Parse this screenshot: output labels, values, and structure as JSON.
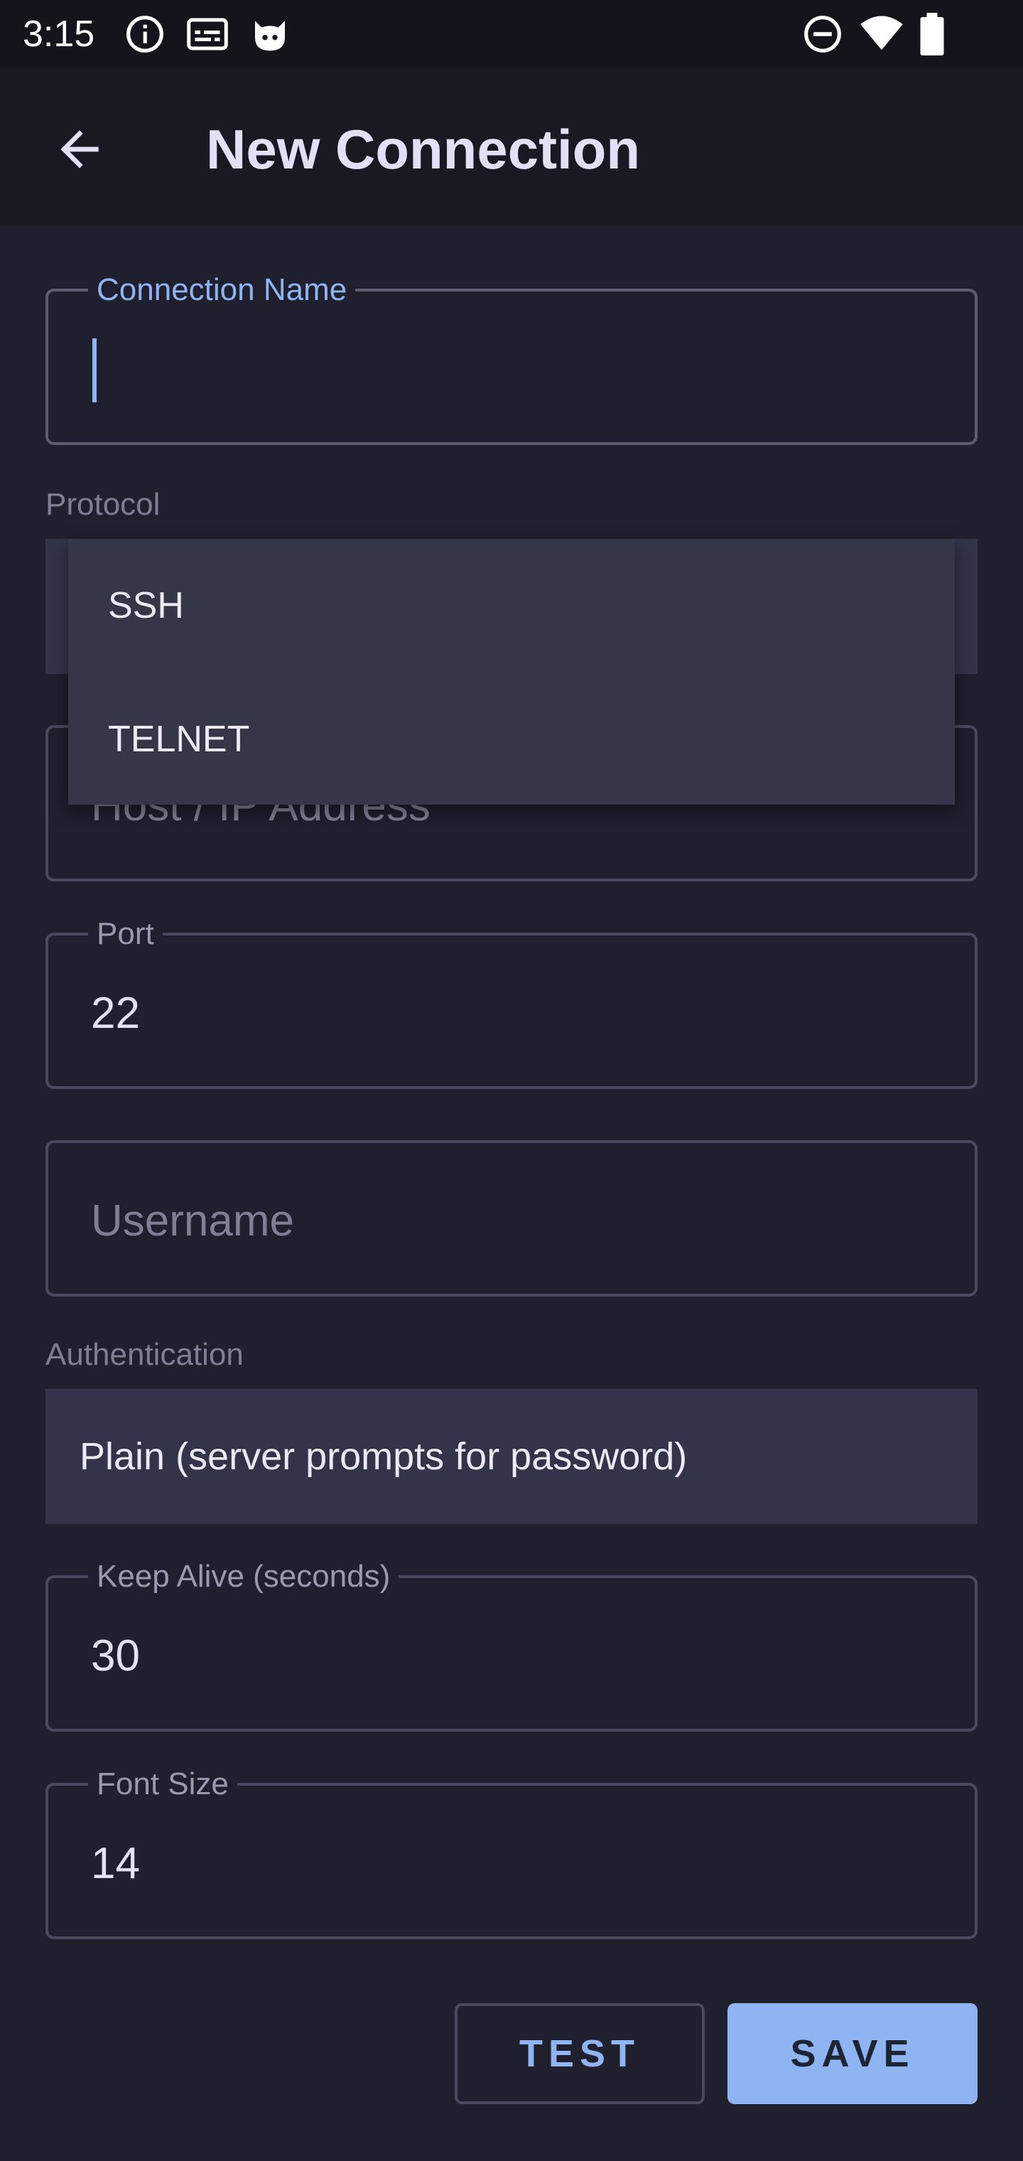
{
  "status_bar": {
    "time": "3:15",
    "left_icons": [
      "info-icon",
      "subtitles-icon",
      "cat-face-icon"
    ],
    "right_icons": [
      "do-not-disturb-icon",
      "wifi-icon",
      "battery-icon"
    ]
  },
  "app_bar": {
    "back_icon": "arrow-back-icon",
    "title": "New Connection"
  },
  "form": {
    "connection_name": {
      "label": "Connection Name",
      "value": ""
    },
    "protocol": {
      "label": "Protocol",
      "options": [
        "SSH",
        "TELNET"
      ]
    },
    "host": {
      "placeholder": "Host / IP Address"
    },
    "port": {
      "label": "Port",
      "value": "22"
    },
    "username": {
      "placeholder": "Username"
    },
    "authentication": {
      "label": "Authentication",
      "value": "Plain (server prompts for password)"
    },
    "keep_alive": {
      "label": "Keep Alive (seconds)",
      "value": "30"
    },
    "font_size": {
      "label": "Font Size",
      "value": "14"
    }
  },
  "actions": {
    "test_label": "TEST",
    "save_label": "SAVE"
  },
  "colors": {
    "background": "#1f1f2e",
    "app_bar": "#191923",
    "accent": "#8fb4f2",
    "menu": "#363649",
    "select": "#33334a"
  }
}
